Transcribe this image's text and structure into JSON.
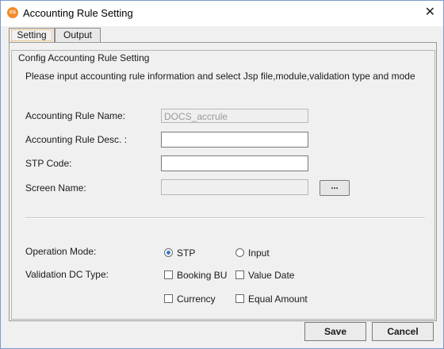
{
  "window": {
    "title": "Accounting Rule Setting",
    "close_glyph": "✕",
    "app_icon_text": "cs"
  },
  "tabs": [
    {
      "label": "Setting",
      "active": true
    },
    {
      "label": "Output",
      "active": false
    }
  ],
  "group": {
    "legend": "Config Accounting Rule Setting",
    "instruction": "Please input accounting rule information and select Jsp file,module,validation type and mode"
  },
  "form": {
    "rule_name": {
      "label": "Accounting Rule Name:",
      "value": "DOCS_accrule",
      "disabled": true
    },
    "rule_desc": {
      "label": "Accounting Rule Desc. :",
      "value": ""
    },
    "stp_code": {
      "label": "STP Code:",
      "value": ""
    },
    "screen_name": {
      "label": "Screen Name:",
      "value": "",
      "disabled": true,
      "browse_label": "..."
    }
  },
  "operation_mode": {
    "label": "Operation Mode:",
    "options": [
      {
        "label": "STP",
        "selected": true
      },
      {
        "label": "Input",
        "selected": false
      }
    ]
  },
  "validation_dc_type": {
    "label": "Validation DC Type:",
    "options": [
      {
        "label": "Booking BU",
        "checked": false
      },
      {
        "label": "Value Date",
        "checked": false
      },
      {
        "label": "Currency",
        "checked": false
      },
      {
        "label": "Equal Amount",
        "checked": false
      }
    ]
  },
  "buttons": {
    "save": "Save",
    "cancel": "Cancel"
  },
  "colors": {
    "accent_radio": "#3a78c8",
    "app_icon": "#f28b2c",
    "window_border": "#7a9ccf"
  }
}
